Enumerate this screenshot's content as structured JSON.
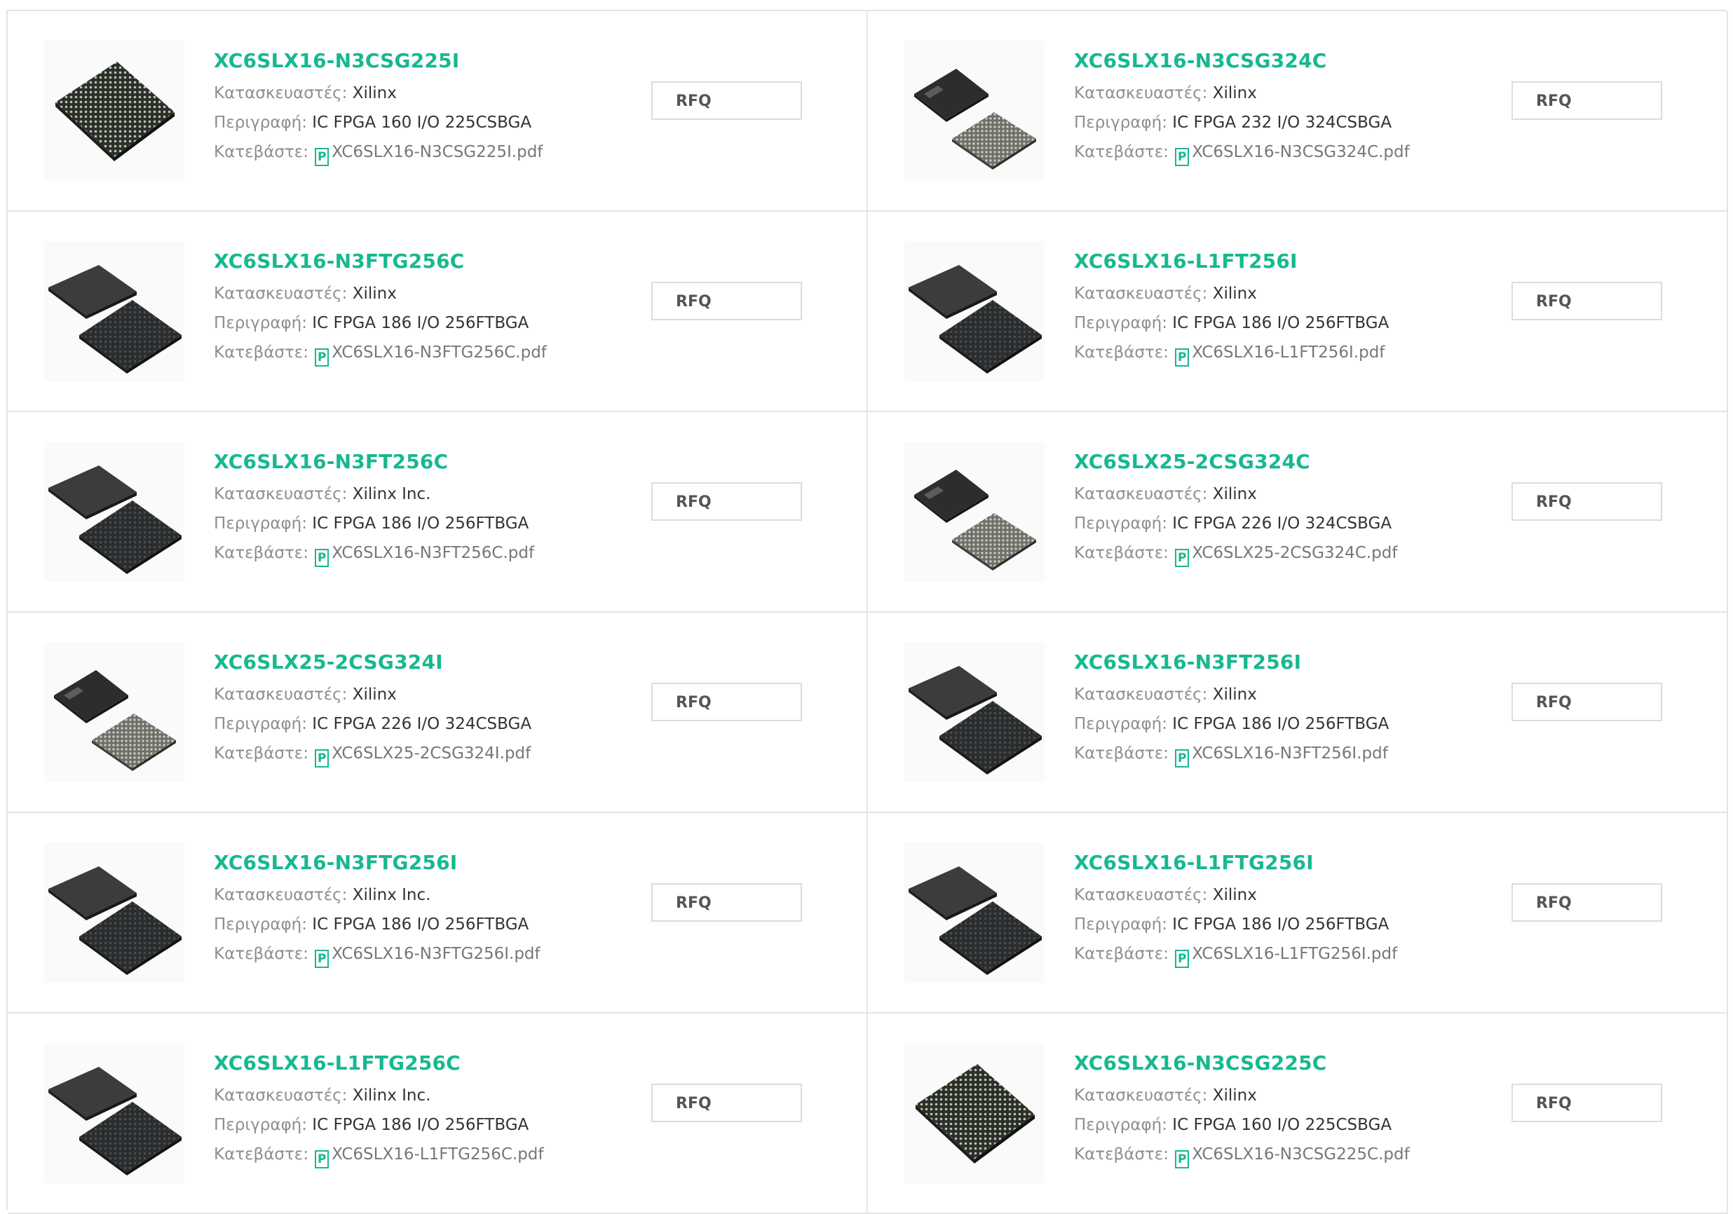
{
  "labels": {
    "manufacturer": "Κατασκευαστές:",
    "description": "Περιγραφή:",
    "download": "Κατεβάστε:",
    "rfq": "RFQ",
    "pdf_glyph": "P"
  },
  "colors": {
    "accent": "#17b890",
    "border": "#e4e4e4"
  },
  "products": [
    {
      "part": "XC6SLX16-N3CSG225I",
      "manufacturer": "Xilinx",
      "description": "IC FPGA 160 I/O 225CSBGA",
      "pdf": "XC6SLX16-N3CSG225I.pdf",
      "image": "chip-single"
    },
    {
      "part": "XC6SLX16-N3CSG324C",
      "manufacturer": "Xilinx",
      "description": "IC FPGA 232 I/O 324CSBGA",
      "pdf": "XC6SLX16-N3CSG324C.pdf",
      "image": "chip-csg-pair"
    },
    {
      "part": "XC6SLX16-N3FTG256C",
      "manufacturer": "Xilinx",
      "description": "IC FPGA 186 I/O 256FTBGA",
      "pdf": "XC6SLX16-N3FTG256C.pdf",
      "image": "chip-ft-pair"
    },
    {
      "part": "XC6SLX16-L1FT256I",
      "manufacturer": "Xilinx",
      "description": "IC FPGA 186 I/O 256FTBGA",
      "pdf": "XC6SLX16-L1FT256I.pdf",
      "image": "chip-ft-pair"
    },
    {
      "part": "XC6SLX16-N3FT256C",
      "manufacturer": "Xilinx Inc.",
      "description": "IC FPGA 186 I/O 256FTBGA",
      "pdf": "XC6SLX16-N3FT256C.pdf",
      "image": "chip-ft-pair"
    },
    {
      "part": "XC6SLX25-2CSG324C",
      "manufacturer": "Xilinx",
      "description": "IC FPGA 226 I/O 324CSBGA",
      "pdf": "XC6SLX25-2CSG324C.pdf",
      "image": "chip-csg-pair"
    },
    {
      "part": "XC6SLX25-2CSG324I",
      "manufacturer": "Xilinx",
      "description": "IC FPGA 226 I/O 324CSBGA",
      "pdf": "XC6SLX25-2CSG324I.pdf",
      "image": "chip-csg-pair"
    },
    {
      "part": "XC6SLX16-N3FT256I",
      "manufacturer": "Xilinx",
      "description": "IC FPGA 186 I/O 256FTBGA",
      "pdf": "XC6SLX16-N3FT256I.pdf",
      "image": "chip-ft-pair"
    },
    {
      "part": "XC6SLX16-N3FTG256I",
      "manufacturer": "Xilinx Inc.",
      "description": "IC FPGA 186 I/O 256FTBGA",
      "pdf": "XC6SLX16-N3FTG256I.pdf",
      "image": "chip-ft-pair"
    },
    {
      "part": "XC6SLX16-L1FTG256I",
      "manufacturer": "Xilinx",
      "description": "IC FPGA 186 I/O 256FTBGA",
      "pdf": "XC6SLX16-L1FTG256I.pdf",
      "image": "chip-ft-pair"
    },
    {
      "part": "XC6SLX16-L1FTG256C",
      "manufacturer": "Xilinx Inc.",
      "description": "IC FPGA 186 I/O 256FTBGA",
      "pdf": "XC6SLX16-L1FTG256C.pdf",
      "image": "chip-ft-pair"
    },
    {
      "part": "XC6SLX16-N3CSG225C",
      "manufacturer": "Xilinx",
      "description": "IC FPGA 160 I/O 225CSBGA",
      "pdf": "XC6SLX16-N3CSG225C.pdf",
      "image": "chip-single"
    }
  ]
}
